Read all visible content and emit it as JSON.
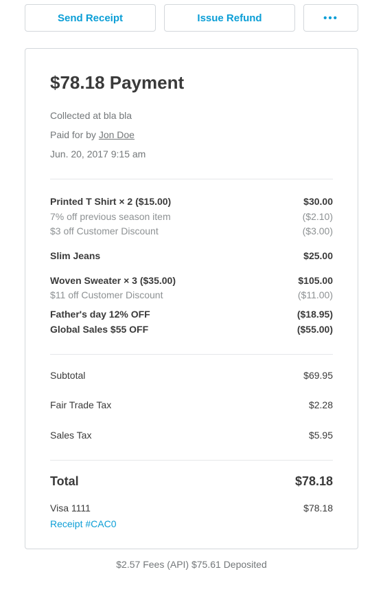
{
  "actions": {
    "send_receipt": "Send Receipt",
    "issue_refund": "Issue Refund",
    "more": "•••"
  },
  "payment": {
    "title": "$78.18 Payment",
    "collected_prefix": "Collected at ",
    "collected_at": "bla bla",
    "paid_prefix": "Paid for by ",
    "payer": "Jon Doe",
    "datetime": "Jun. 20, 2017 9:15 am"
  },
  "items": [
    {
      "name": "Printed T Shirt × 2 ($15.00)",
      "amount": "$30.00",
      "subs": [
        {
          "label": "7% off previous season item",
          "amount": "($2.10)"
        },
        {
          "label": "$3 off Customer Discount",
          "amount": "($3.00)"
        }
      ]
    },
    {
      "name": "Slim Jeans",
      "amount": "$25.00",
      "subs": []
    },
    {
      "name": "Woven Sweater × 3 ($35.00)",
      "amount": "$105.00",
      "subs": [
        {
          "label": "$11 off Customer Discount",
          "amount": "($11.00)"
        }
      ]
    }
  ],
  "order_discounts": [
    {
      "label": "Father's day 12% OFF",
      "amount": "($18.95)"
    },
    {
      "label": "Global Sales $55 OFF",
      "amount": "($55.00)"
    }
  ],
  "totals": {
    "subtotal_label": "Subtotal",
    "subtotal_amount": "$69.95",
    "tax1_label": "Fair Trade Tax",
    "tax1_amount": "$2.28",
    "tax2_label": "Sales Tax",
    "tax2_amount": "$5.95"
  },
  "grand": {
    "label": "Total",
    "amount": "$78.18"
  },
  "tender": {
    "method": "Visa 1111",
    "amount": "$78.18",
    "receipt_link": "Receipt #CAC0"
  },
  "footer": "$2.57 Fees (API) $75.61 Deposited"
}
